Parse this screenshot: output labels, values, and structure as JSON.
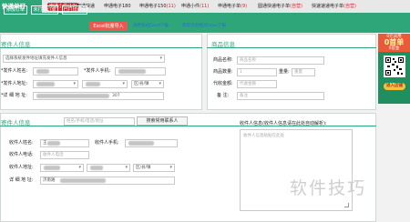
{
  "topbar": {
    "brand": "快递单打",
    "tabs": [
      {
        "label": "申通小件",
        "count": "(17)",
        "pill": true
      },
      {
        "label": "申通快递",
        "count": "",
        "pill": false
      },
      {
        "label": "申通电子180",
        "count": "",
        "pill": false
      },
      {
        "label": "申通电子150",
        "count": "(11)",
        "pill": false
      },
      {
        "label": "申通小件",
        "count": "(11)",
        "pill": false
      },
      {
        "label": "申通电子单",
        "count": "(9)",
        "pill": false
      },
      {
        "label": "圆通快递电子单",
        "count": "(自营)",
        "pill": false
      },
      {
        "label": "快速速递电子单",
        "count": "(自营)",
        "pill": false
      }
    ]
  },
  "subbar": {
    "btn1": "添加订单",
    "btn2": "未打印订单",
    "btn3": "已打印订单"
  },
  "import_btn": "Excel批量导入",
  "hint1": "通用格式Excel下载",
  "hint2": "帮帮识别格式Excel下载",
  "sender": {
    "title": "寄件人信息",
    "select_placeholder": "选择系统发件地址填充发件人信息",
    "name_label": "*发件人姓名:",
    "phone_label": "*发件人手机:",
    "addr_label": "*发件人地址:",
    "detail_label": "*详 细 地 址:",
    "city_value": "市/县",
    "district_value": "区/县/镇",
    "postcode_tail": "307"
  },
  "goods": {
    "title": "商品信息",
    "name_label": "商品名称:",
    "name_placeholder": "商品名称",
    "count_label": "商品数量:",
    "count_placeholder": "1",
    "weight_label": "重量:",
    "weight_placeholder": "重量",
    "cod_label": "代收金额:",
    "cod_placeholder": "代收金额",
    "remark_label": "备 注:",
    "remark_placeholder": "备注"
  },
  "ad": {
    "line1": "0元试用",
    "line2": "0首单",
    "line3": "0首金",
    "btn": "进入店铺"
  },
  "receiver": {
    "title": "寄件人信息",
    "search_placeholder": "姓名/手机/电话/地址",
    "search_btn": "搜索常用联系人",
    "name_label": "收件人姓名:",
    "name_value": "王",
    "mobile_label": "收件人手机:",
    "phone_label": "收件人电话:",
    "phone_placeholder": "收件人电话",
    "addr_label": "收件人地址:",
    "district_value": "区/县/镇",
    "detail_label": "详 细 地 址:",
    "detail_value": "济南路",
    "parse_label": "收件人信息(收件人信息请在此处自动解析):",
    "parse_placeholder": "收件人信息粘贴在此处"
  },
  "watermark": "软件技巧"
}
